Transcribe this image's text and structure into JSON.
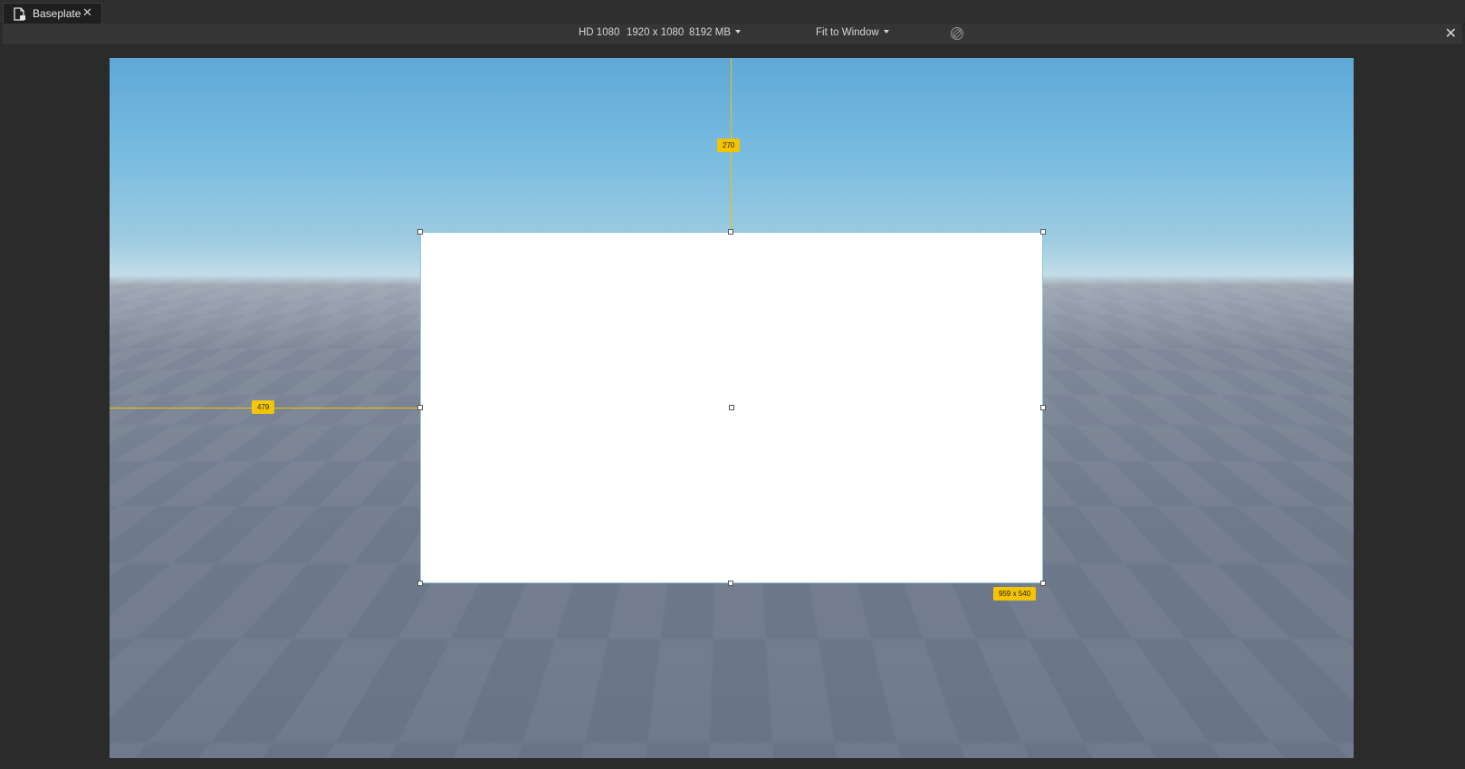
{
  "tab": {
    "title": "Baseplate",
    "close_label": "✕",
    "icon": "script-file-icon"
  },
  "toolbar": {
    "resolution_name": "HD 1080",
    "resolution_size": "1920 x 1080",
    "memory": "8192 MB",
    "fit_mode": "Fit to Window",
    "rotate_icon": "rotate-device-icon",
    "close_label": "✕"
  },
  "viewport": {
    "top_offset_label": "270",
    "left_offset_label": "479",
    "size_label": "959 x 540",
    "guide_color": "#f5c400",
    "frame_color": "#ffffff"
  }
}
